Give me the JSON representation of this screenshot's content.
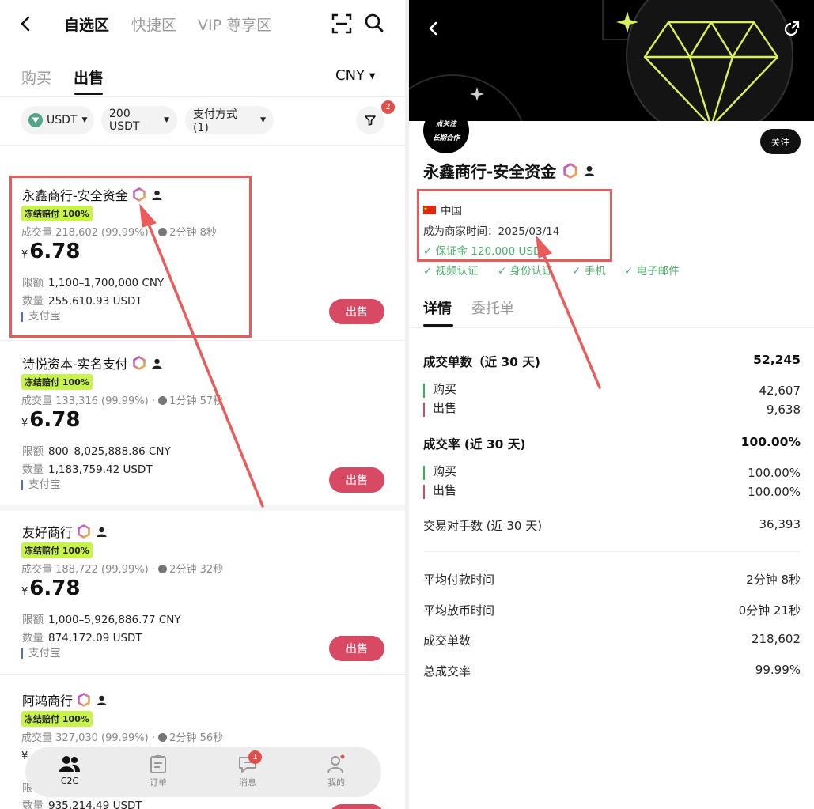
{
  "left": {
    "top_tabs": [
      "自选区",
      "快捷区",
      "VIP 尊享区"
    ],
    "sub_tabs": [
      "购买",
      "出售"
    ],
    "currency": "CNY",
    "filters": {
      "coin": "USDT",
      "amount": "200 USDT",
      "payment": "支付方式 (1)",
      "filter_badge": "2"
    },
    "merchants": [
      {
        "name": "永鑫商行-安全资金",
        "freeze": "冻结赔付 100%",
        "volume": "成交量 218,602 (99.99%)",
        "dot": "·",
        "time": "2分钟 8秒",
        "yen": "¥",
        "price": "6.78",
        "limit_label": "限额",
        "limit": "1,100–1,700,000 CNY",
        "qty_label": "数量",
        "qty": "255,610.93 USDT",
        "pay": "支付宝",
        "action": "出售"
      },
      {
        "name": "诗悦资本-实名支付",
        "freeze": "冻结赔付 100%",
        "volume": "成交量 133,316 (99.99%)",
        "dot": "·",
        "time": "1分钟 57秒",
        "yen": "¥",
        "price": "6.78",
        "limit_label": "限额",
        "limit": "800–8,025,888.86 CNY",
        "qty_label": "数量",
        "qty": "1,183,759.42 USDT",
        "pay": "支付宝",
        "action": "出售"
      },
      {
        "name": "友好商行",
        "freeze": "冻结赔付 100%",
        "volume": "成交量 188,722 (99.99%)",
        "dot": "·",
        "time": "2分钟 32秒",
        "yen": "¥",
        "price": "6.78",
        "limit_label": "限额",
        "limit": "1,000–5,926,886.77 CNY",
        "qty_label": "数量",
        "qty": "874,172.09 USDT",
        "pay": "支付宝",
        "action": "出售"
      },
      {
        "name": "阿鸿商行",
        "freeze": "冻结赔付 100%",
        "volume": "成交量 327,030 (99.99%)",
        "dot": "·",
        "time": "2分钟 56秒",
        "yen": "¥",
        "limit_label": "限",
        "qty_label": "数量",
        "qty": "935,214.49 USDT"
      }
    ],
    "bottom_nav": [
      {
        "label": "C2C",
        "icon": "users-icon"
      },
      {
        "label": "订单",
        "icon": "clipboard-icon"
      },
      {
        "label": "消息",
        "icon": "message-icon",
        "badge": "1"
      },
      {
        "label": "我的",
        "icon": "profile-icon"
      }
    ]
  },
  "right": {
    "avatar_lines": [
      "点关注",
      "长期合作"
    ],
    "follow": "关注",
    "merchant_name": "永鑫商行-安全资金",
    "country": "中国",
    "since": "成为商家时间：2025/03/14",
    "deposit": "✓ 保证金 120,000 USD",
    "verifications": [
      "✓ 视频认证",
      "✓ 身份认证",
      "✓ 手机",
      "✓ 电子邮件"
    ],
    "tabs": [
      "详情",
      "委托单"
    ],
    "stats": {
      "orders_label": "成交单数（近 30 天)",
      "orders_value": "52,245",
      "buy_label": "购买",
      "buy_orders": "42,607",
      "sell_label": "出售",
      "sell_orders": "9,638",
      "rate_label": "成交率 (近 30 天)",
      "rate_value": "100.00%",
      "buy_rate": "100.00%",
      "sell_rate": "100.00%",
      "counterparties_label": "交易对手数 (近 30 天)",
      "counterparties_value": "36,393",
      "avg_pay_label": "平均付款时间",
      "avg_pay_value": "2分钟 8秒",
      "avg_release_label": "平均放币时间",
      "avg_release_value": "0分钟 21秒",
      "total_orders_label": "成交单数",
      "total_orders_value": "218,602",
      "total_rate_label": "总成交率",
      "total_rate_value": "99.99%"
    }
  },
  "colors": {
    "sell_button": "#d84a63",
    "freeze_badge": "#c8f34a",
    "verified": "#4caf6c",
    "highlight": "#e45d5d",
    "banner_lime": "#d8f25a"
  }
}
